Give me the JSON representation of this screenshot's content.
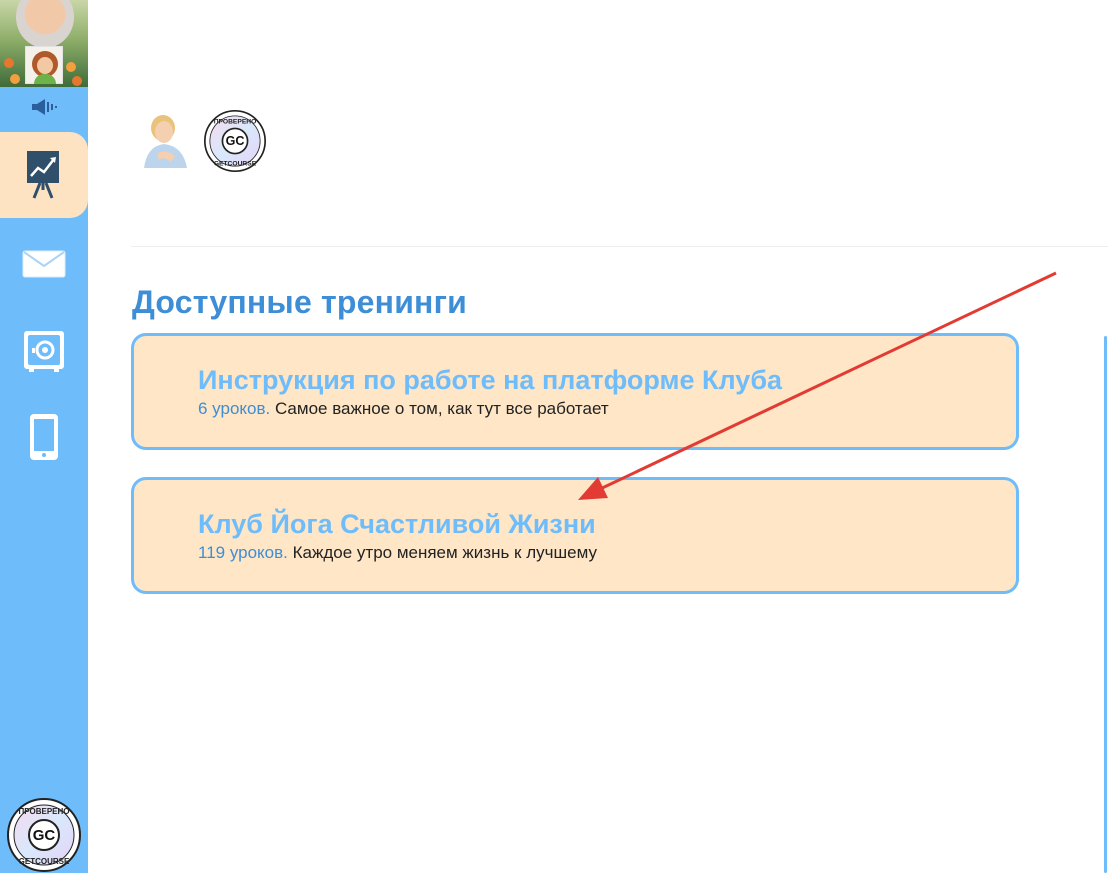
{
  "sidebar": {
    "nav_items": [
      {
        "name": "trainings",
        "icon": "presentation-chart-icon",
        "active": true
      },
      {
        "name": "messages",
        "icon": "envelope-icon",
        "active": false
      },
      {
        "name": "safe",
        "icon": "safe-icon",
        "active": false
      },
      {
        "name": "mobile",
        "icon": "smartphone-icon",
        "active": false
      }
    ],
    "badge": {
      "top_text": "ПРОВЕРЕНО",
      "center_text": "GC",
      "bottom_text": "GETCOURSE"
    }
  },
  "header": {
    "badge": {
      "top_text": "ПРОВЕРЕНО",
      "center_text": "GC",
      "bottom_text": "GETCOURSE"
    }
  },
  "section": {
    "title": "Доступные тренинги"
  },
  "trainings": [
    {
      "title": "Инструкция по работе на платформе Клуба",
      "count": "6 уроков.",
      "description": "Самое важное о том, как тут все работает"
    },
    {
      "title": "Клуб Йога Счастливой Жизни",
      "count": "119 уроков.",
      "description": "Каждое утро меняем жизнь к лучшему"
    }
  ],
  "colors": {
    "sidebar": "#6fbcfb",
    "card_bg": "#fee6c6",
    "card_border": "#6fbcfb",
    "title_blue": "#3d8ed6",
    "arrow": "#e23b33"
  }
}
